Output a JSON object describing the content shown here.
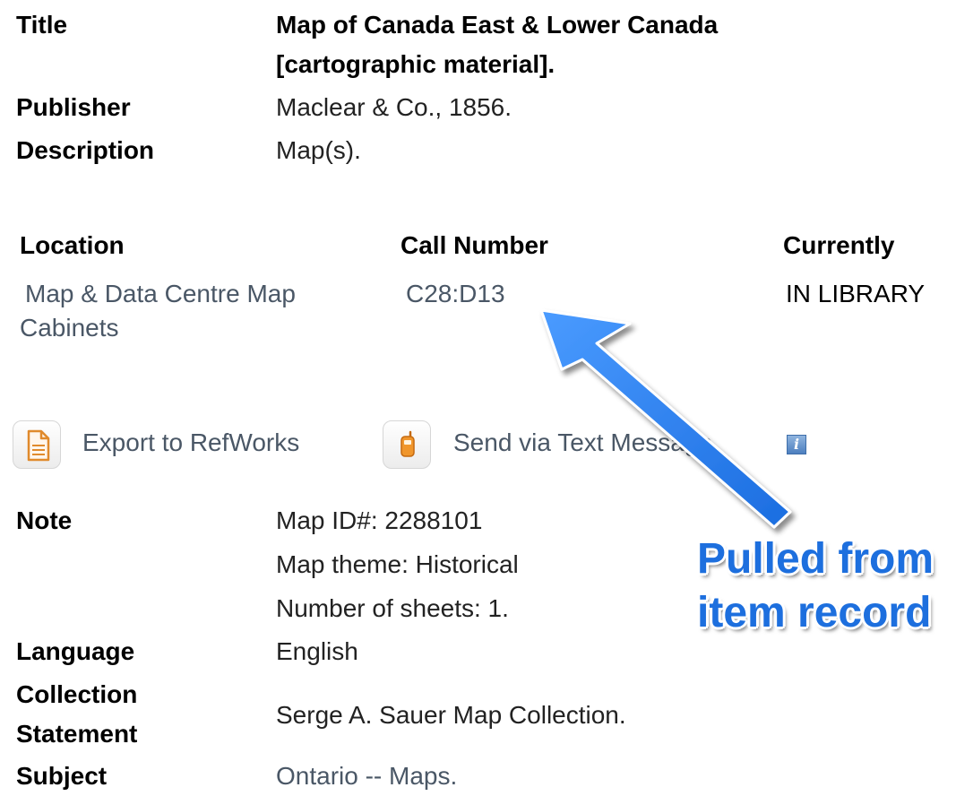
{
  "record": {
    "title_label": "Title",
    "title_line1": "Map of Canada East & Lower Canada",
    "title_line2": "[cartographic material].",
    "publisher_label": "Publisher",
    "publisher_value": "Maclear & Co., 1856.",
    "description_label": "Description",
    "description_value": "Map(s)."
  },
  "holdings": {
    "headers": {
      "location": "Location",
      "call_number": "Call Number",
      "currently": "Currently"
    },
    "rows": [
      {
        "location_line1": "Map & Data Centre Map",
        "location_line2": "Cabinets",
        "call_number": "C28:D13",
        "status": "IN LIBRARY"
      }
    ]
  },
  "actions": {
    "export_label": "Export to RefWorks",
    "export_icon": "document-icon",
    "send_label": "Send via Text Message",
    "send_icon": "mobile-phone-icon",
    "info_icon": "info-icon"
  },
  "details": {
    "note_label": "Note",
    "note_lines": [
      "Map ID#: 2288101",
      "Map theme: Historical",
      "Number of sheets: 1."
    ],
    "language_label": "Language",
    "language_value": "English",
    "collection_label_line1": "Collection",
    "collection_label_line2": "Statement",
    "collection_value": "Serge A. Sauer Map Collection.",
    "subject_label": "Subject",
    "subject_value": "Ontario -- Maps."
  },
  "annotation": {
    "callout_line1": "Pulled from",
    "callout_line2": "item record",
    "color": "#1d6fde"
  },
  "colors": {
    "link": "#4a5766",
    "label": "#000000"
  }
}
